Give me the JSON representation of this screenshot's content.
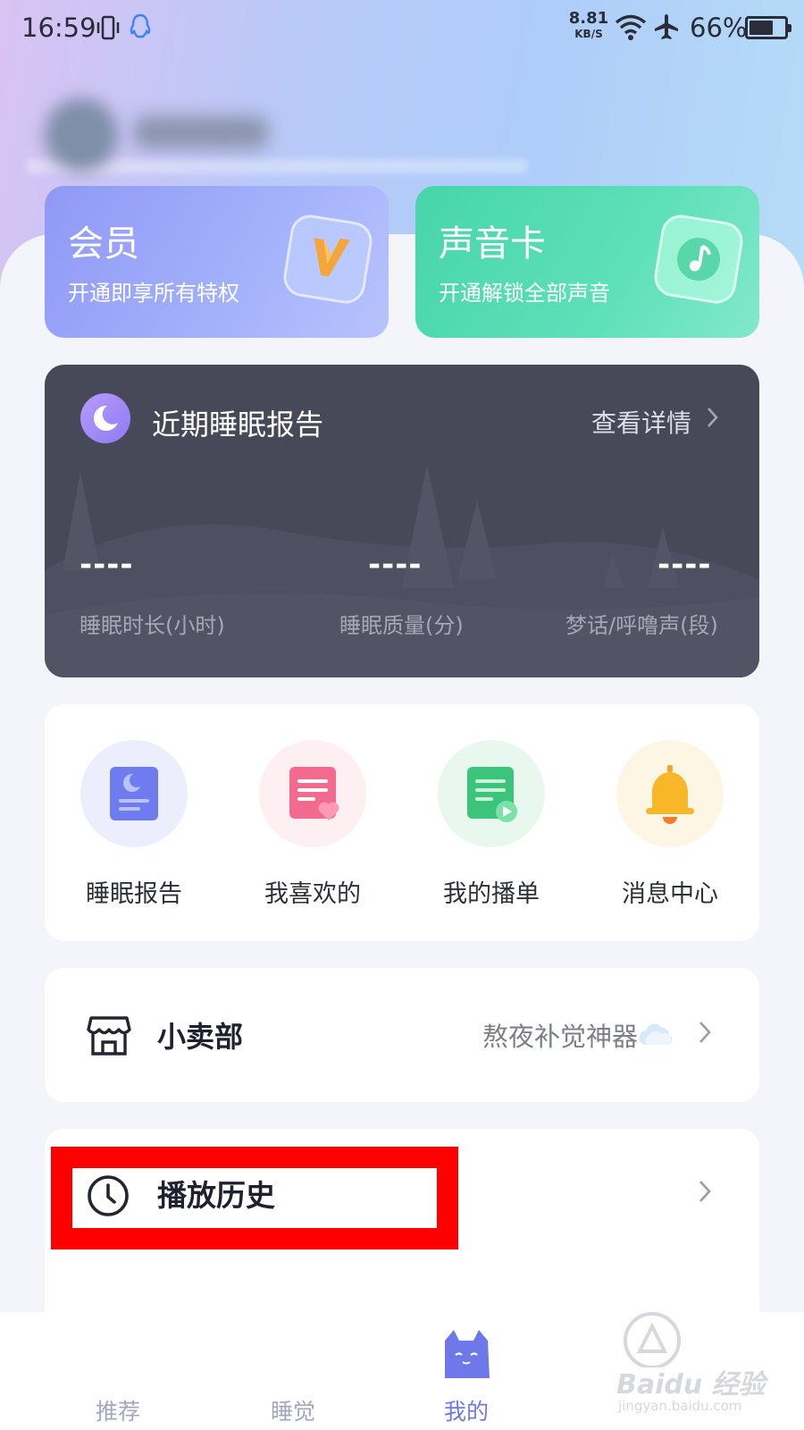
{
  "status_bar": {
    "time": "16:59",
    "net_speed_value": "8.81",
    "net_speed_unit": "KB/S",
    "battery": "66%",
    "battery_level": 0.66
  },
  "promo_cards": {
    "member": {
      "title": "会员",
      "subtitle": "开通即享所有特权"
    },
    "sound_card": {
      "title": "声音卡",
      "subtitle": "开通解锁全部声音"
    }
  },
  "sleep_report": {
    "title": "近期睡眠报告",
    "detail_link": "查看详情",
    "metrics": [
      {
        "value": "----",
        "label": "睡眠时长(小时)"
      },
      {
        "value": "----",
        "label": "睡眠质量(分)"
      },
      {
        "value": "----",
        "label": "梦话/呼噜声(段)"
      }
    ]
  },
  "shortcuts": [
    {
      "label": "睡眠报告",
      "icon": "report-icon"
    },
    {
      "label": "我喜欢的",
      "icon": "favorites-icon"
    },
    {
      "label": "我的播单",
      "icon": "playlist-icon"
    },
    {
      "label": "消息中心",
      "icon": "bell-icon"
    }
  ],
  "store": {
    "title": "小卖部",
    "promo": "熬夜补觉神器"
  },
  "history": {
    "title": "播放历史"
  },
  "bottom_nav": {
    "items": [
      {
        "label": "推荐",
        "active": false
      },
      {
        "label": "睡觉",
        "active": false
      },
      {
        "label": "我的",
        "active": true
      }
    ]
  },
  "watermark": {
    "main": "Baidu 经验",
    "sub": "jingyan.baidu.com"
  },
  "colors": {
    "accent": "#6e78e8",
    "sleep_card_bg": "#474858",
    "highlight": "#ff0000"
  }
}
